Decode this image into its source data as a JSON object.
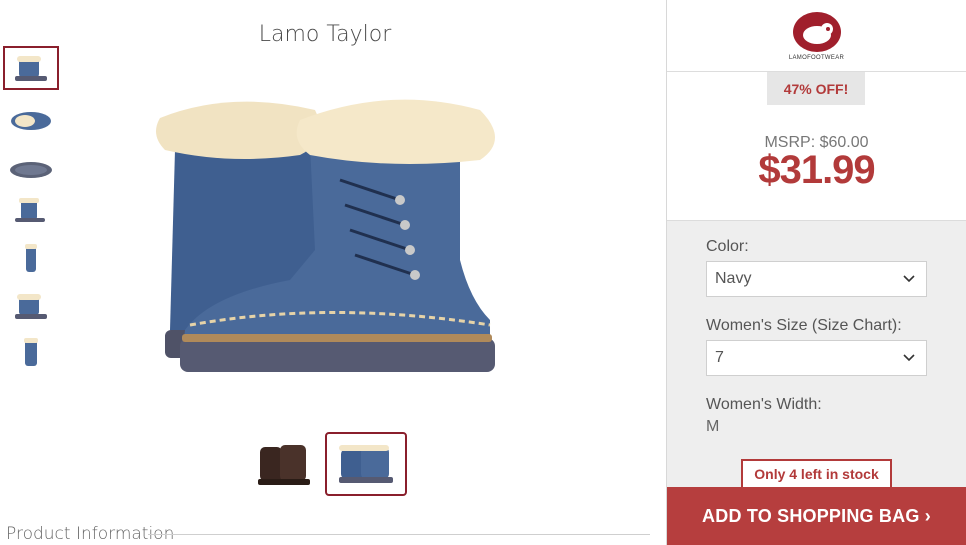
{
  "product": {
    "title": "Lamo Taylor"
  },
  "brand": {
    "name": "LAMOFOOTWEAR"
  },
  "pricing": {
    "discount": "47% OFF!",
    "msrp": "MSRP: $60.00",
    "price": "$31.99"
  },
  "options": {
    "color_label": "Color:",
    "color_value": "Navy",
    "size_label": "Women's Size (Size Chart):",
    "size_value": "7",
    "width_label": "Women's Width:",
    "width_value": "M"
  },
  "stock": {
    "text": "Only 4 left in stock"
  },
  "cta": {
    "label": "ADD TO SHOPPING BAG ›"
  },
  "section": {
    "title": "Product Information"
  },
  "colors": {
    "accent": "#b23a3a",
    "selected_border": "#8a1f2c",
    "boot_navy": "#4a6a9a",
    "boot_brown": "#3a2620"
  }
}
